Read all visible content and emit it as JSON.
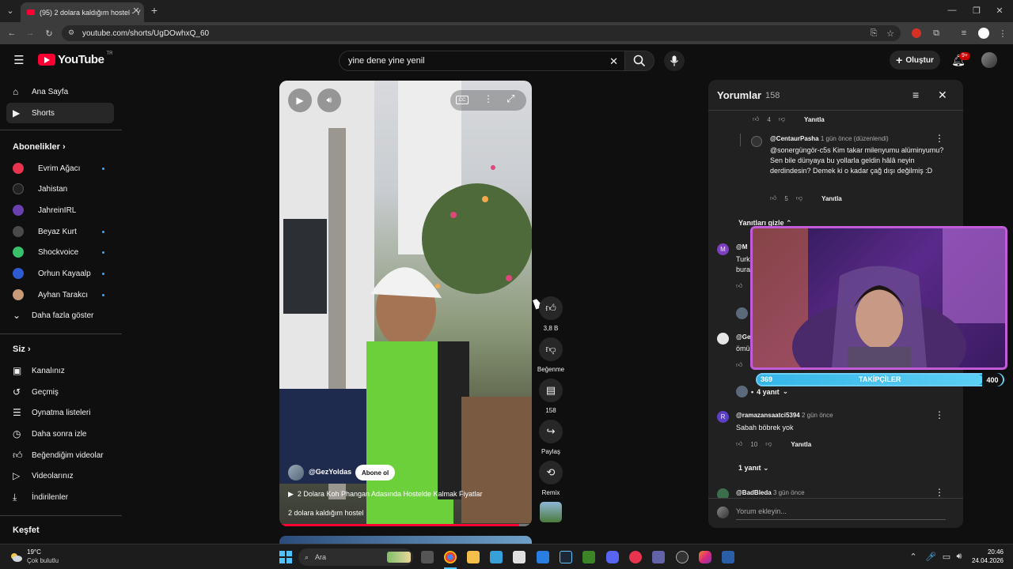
{
  "browser": {
    "tab_title": "(95) 2 dolara kaldığım hostel - Y",
    "url": "youtube.com/shorts/UgDOwhxQ_60"
  },
  "header": {
    "logo_text": "YouTube",
    "logo_sup": "TR",
    "search_value": "yine dene yine yenil",
    "create_label": "Oluştur",
    "notif_badge": "9+"
  },
  "sidebar": {
    "home": "Ana Sayfa",
    "shorts": "Shorts",
    "subs_heading": "Abonelikler",
    "subs": [
      {
        "name": "Evrim Ağacı",
        "color": "#e8344e",
        "dot": true
      },
      {
        "name": "Jahistan",
        "color": "#222222",
        "dot": false
      },
      {
        "name": "JahreinIRL",
        "color": "#6a3fb0",
        "dot": false
      },
      {
        "name": "Beyaz Kurt",
        "color": "#4a4a4a",
        "dot": true
      },
      {
        "name": "Shockvoice",
        "color": "#39c06b",
        "dot": true
      },
      {
        "name": "Orhun Kayaalp",
        "color": "#2e5bd1",
        "dot": true
      },
      {
        "name": "Ayhan Tarakcı",
        "color": "#c89a7a",
        "dot": true
      }
    ],
    "more": "Daha fazla göster",
    "you_heading": "Siz",
    "you_items": [
      "Kanalınız",
      "Geçmiş",
      "Oynatma listeleri",
      "Daha sonra izle",
      "Beğendiğim videolar",
      "Videolarınız",
      "İndirilenler"
    ],
    "explore_heading": "Keşfet"
  },
  "video": {
    "channel": "@GezYoldas",
    "subscribe": "Abone ol",
    "linked_video": "2 Dolara Koh Phangan Adasında Hostelde Kalmak Fiyatlar",
    "title": "2 dolara kaldığım hostel",
    "progress": 0.95
  },
  "actions": {
    "likes": "3,8 B",
    "dislike": "Beğenme",
    "comments": "158",
    "share": "Paylaş",
    "remix": "Remix"
  },
  "comments": {
    "title": "Yorumlar",
    "count": "158",
    "top_likes": "4",
    "reply": "Yanıtla",
    "c1_user": "@CentaurPasha",
    "c1_meta": "1 gün önce (düzenlendi)",
    "c1_text": "@sonergüngör-c5s Kim takar milenyumu alüminyumu? Sen bile dünyaya bu yollarla geldin hâlâ neyin derdindesin? Demek ki o kadar çağ dışı değilmiş :D",
    "c1_likes": "5",
    "hide_replies": "Yanıtları gizle",
    "c2_user": "@M",
    "c2_text1": "Turk",
    "c2_text2": "bura",
    "c3_user": "@Ge",
    "c3_text": "ömü",
    "replies_4": "4 yanıt",
    "c4_user": "@ramazansaatci5394",
    "c4_meta": "2 gün önce",
    "c4_text": "Sabah böbrek yok",
    "c4_likes": "10",
    "replies_1": "1 yanıt",
    "c5_user": "@BadBleda",
    "c5_meta": "3 gün önce",
    "input_placeholder": "Yorum ekleyin..."
  },
  "overlay": {
    "followers_label": "TAKİPÇİLER",
    "followers_current": "369",
    "followers_goal": "400",
    "progress": 0.92
  },
  "taskbar": {
    "temp": "19°C",
    "weather": "Çok bulutlu",
    "search": "Ara",
    "time": "20:46",
    "date": "24.04.2026"
  }
}
